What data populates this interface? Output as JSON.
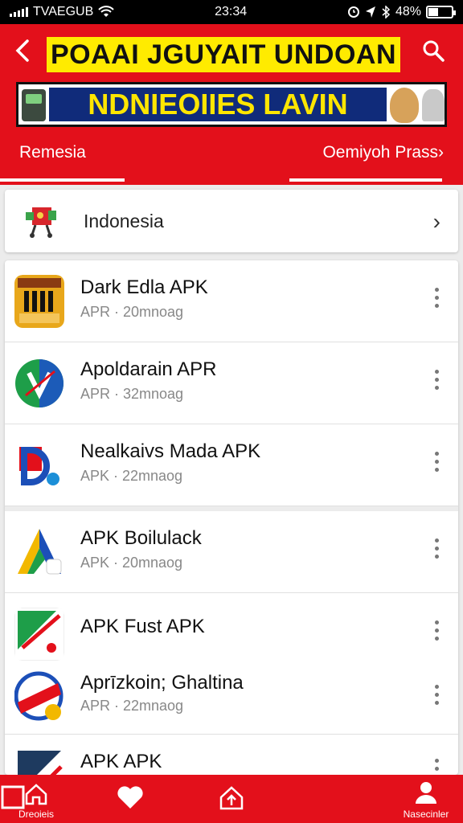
{
  "status_bar": {
    "carrier": "TVAEGUB",
    "time": "23:34",
    "battery": "48%"
  },
  "header": {
    "title": "POAAI JGUYAIT UNDOAN",
    "banner": "NDNIEOIIES LAVIN",
    "tab_left": "Remesia",
    "tab_right": "Oemiyoh Prass",
    "tab_right_chevron": "›"
  },
  "country": {
    "label": "Indonesia",
    "chevron": "›"
  },
  "apps": [
    {
      "name": "Dark Edla APK",
      "meta": "APR · 20mnoag",
      "icon": "yellow-bars-icon"
    },
    {
      "name": "Apoldarain APR",
      "meta": "APR · 32mnoag",
      "icon": "green-blue-circle-icon"
    },
    {
      "name": "Nealkaivs Mada APK",
      "meta": "APK · 22mnaog",
      "icon": "red-blue-d-icon"
    },
    {
      "name": "APK Boilulack",
      "meta": "APK · 20mnaog",
      "icon": "triangle-a-icon"
    },
    {
      "name": "APK Fust APK",
      "meta": "",
      "icon": "green-red-flag-icon"
    },
    {
      "name": "Aprīzkoin; Ghaltina",
      "meta": "APR · 22mnaog",
      "icon": "red-banner-circle-icon"
    },
    {
      "name": "APK APK",
      "meta": "",
      "icon": "dark-triangle-icon"
    }
  ],
  "bottom_nav": [
    {
      "label": "Dreoieis",
      "icon": "home-icon"
    },
    {
      "label": "",
      "icon": "heart-icon"
    },
    {
      "label": "",
      "icon": "share-home-icon"
    },
    {
      "label": "",
      "icon": "square-icon"
    },
    {
      "label": "Nasecinler",
      "icon": "person-icon"
    }
  ],
  "colors": {
    "brand_red": "#e3101b",
    "title_yellow": "#ffeb00",
    "banner_blue": "#102b7a"
  }
}
